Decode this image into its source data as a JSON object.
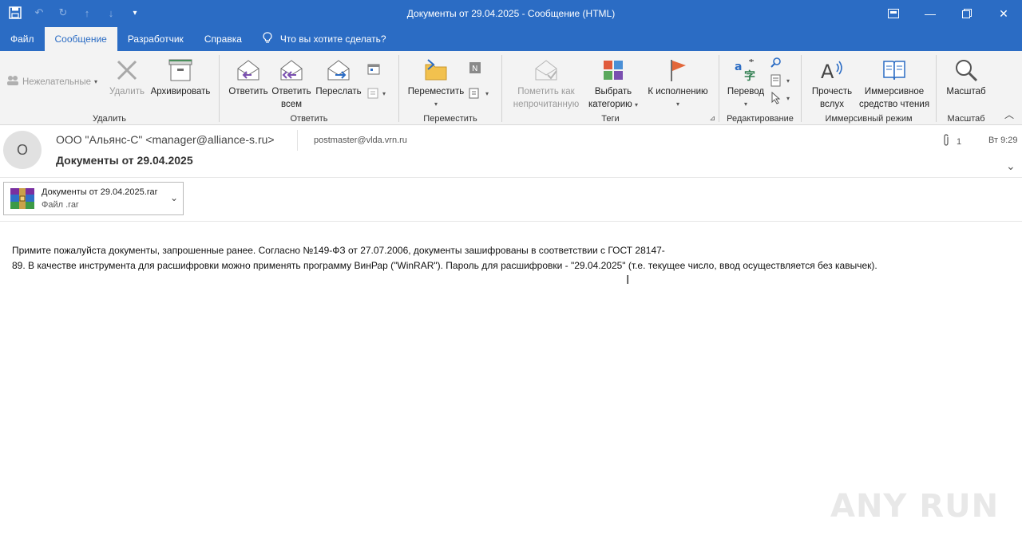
{
  "window": {
    "title": "Документы от 29.04.2025  -  Сообщение (HTML)"
  },
  "tabs": [
    {
      "label": "Файл"
    },
    {
      "label": "Сообщение"
    },
    {
      "label": "Разработчик"
    },
    {
      "label": "Справка"
    },
    {
      "label": "Что вы хотите сделать?"
    }
  ],
  "ribbon": {
    "delete_group": {
      "junk": "Нежелательные",
      "delete": "Удалить",
      "archive": "Архивировать",
      "label": "Удалить"
    },
    "respond_group": {
      "reply": "Ответить",
      "reply_all_1": "Ответить",
      "reply_all_2": "всем",
      "forward": "Переслать",
      "label": "Ответить"
    },
    "move_group": {
      "move": "Переместить",
      "label": "Переместить"
    },
    "tags_group": {
      "mark_unread_1": "Пометить как",
      "mark_unread_2": "непрочитанную",
      "categorize_1": "Выбрать",
      "categorize_2": "категорию",
      "followup": "К исполнению",
      "label": "Теги"
    },
    "editing_group": {
      "translate": "Перевод",
      "label": "Редактирование"
    },
    "immersive_group": {
      "read_aloud_1": "Прочесть",
      "read_aloud_2": "вслух",
      "immersive_1": "Иммерсивное",
      "immersive_2": "средство чтения",
      "label": "Иммерсивный режим"
    },
    "zoom_group": {
      "zoom": "Масштаб",
      "label": "Масштаб"
    }
  },
  "message": {
    "avatar_initial": "O",
    "sender": "ООО \"Альянс-С\" <manager@alliance-s.ru>",
    "recipient": "postmaster@vlda.vrn.ru",
    "subject": "Документы от 29.04.2025",
    "attachment_count": "1",
    "time": "Вт 9:29",
    "attachment": {
      "name": "Документы от 29.04.2025.rar",
      "type": "Файл .rar"
    },
    "body_line1": "Примите пожалуйста документы, запрошенные ранее. Согласно №149-ФЗ от 27.07.2006,  документы зашифрованы в соответствии с ГОСТ 28147-",
    "body_line2": "89.  В качестве инструмента для расшифровки можно применять программу ВинРар (\"WinRAR\"). Пароль для расшифровки - \"29.04.2025\"  (т.е. текущее число, ввод осуществляется без кавычек)."
  },
  "watermark": "ANY RUN",
  "colors": {
    "accent": "#2b6cc4",
    "ribbon_bg": "#f3f3f3"
  }
}
